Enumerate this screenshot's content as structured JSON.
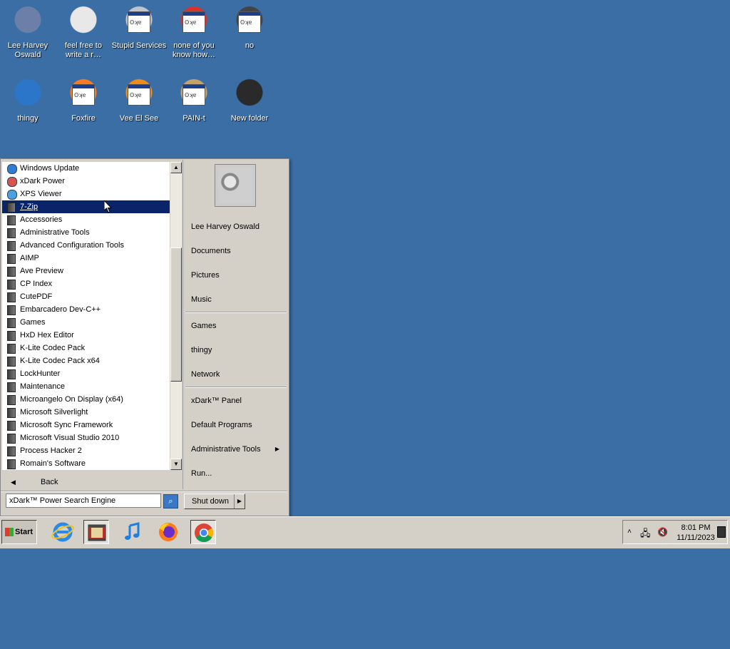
{
  "desktop": {
    "icons": [
      {
        "label": "Lee Harvey\nOswald",
        "icon": "anime-character-icon"
      },
      {
        "label": "feel free to\nwrite a r…",
        "icon": "text-document-icon"
      },
      {
        "label": "Stupid Services",
        "icon": "gear-app-icon"
      },
      {
        "label": "none of you\nknow how…",
        "icon": "red-app-icon"
      },
      {
        "label": "no",
        "icon": "black-box-app-icon"
      },
      {
        "label": "thingy",
        "icon": "blue-orb-icon"
      },
      {
        "label": "Foxfire",
        "icon": "firefox-app-icon"
      },
      {
        "label": "Vee El See",
        "icon": "vlc-app-icon"
      },
      {
        "label": "PAIN-t",
        "icon": "paint-palette-icon"
      },
      {
        "label": "New folder",
        "icon": "dark-folder-icon"
      }
    ]
  },
  "start_menu": {
    "programs": [
      {
        "label": "Windows Update",
        "kind": "app"
      },
      {
        "label": "xDark Power",
        "kind": "app"
      },
      {
        "label": "XPS Viewer",
        "kind": "app"
      },
      {
        "label": "7-Zip",
        "kind": "folder",
        "selected": true
      },
      {
        "label": "Accessories",
        "kind": "folder"
      },
      {
        "label": "Administrative Tools",
        "kind": "folder"
      },
      {
        "label": "Advanced Configuration Tools",
        "kind": "folder"
      },
      {
        "label": "AIMP",
        "kind": "folder"
      },
      {
        "label": "Ave Preview",
        "kind": "folder"
      },
      {
        "label": "CP Index",
        "kind": "folder"
      },
      {
        "label": "CutePDF",
        "kind": "folder"
      },
      {
        "label": "Embarcadero Dev-C++",
        "kind": "folder"
      },
      {
        "label": "Games",
        "kind": "folder"
      },
      {
        "label": "HxD Hex Editor",
        "kind": "folder"
      },
      {
        "label": "K-Lite Codec Pack",
        "kind": "folder"
      },
      {
        "label": "K-Lite Codec Pack x64",
        "kind": "folder"
      },
      {
        "label": "LockHunter",
        "kind": "folder"
      },
      {
        "label": "Maintenance",
        "kind": "folder"
      },
      {
        "label": "Microangelo On Display (x64)",
        "kind": "folder"
      },
      {
        "label": "Microsoft Silverlight",
        "kind": "folder"
      },
      {
        "label": "Microsoft Sync Framework",
        "kind": "folder"
      },
      {
        "label": "Microsoft Visual Studio 2010",
        "kind": "folder"
      },
      {
        "label": "Process Hacker 2",
        "kind": "folder"
      },
      {
        "label": "Romain's Software",
        "kind": "folder"
      }
    ],
    "back_label": "Back",
    "search_value": "xDark™ Power Search Engine",
    "right_items": [
      {
        "label": "Lee Harvey Oswald"
      },
      {
        "label": "Documents"
      },
      {
        "label": "Pictures"
      },
      {
        "label": "Music"
      },
      {
        "label": "Games"
      },
      {
        "label": "thingy"
      },
      {
        "label": "Network"
      },
      {
        "label": "xDark™ Panel"
      },
      {
        "label": "Default Programs"
      },
      {
        "label": "Administrative Tools",
        "submenu": true
      },
      {
        "label": "Run..."
      }
    ],
    "shutdown_label": "Shut down"
  },
  "taskbar": {
    "start_label": "Start",
    "apps": [
      "internet-explorer-icon",
      "film-app-icon",
      "music-note-icon",
      "firefox-icon",
      "chrome-icon"
    ],
    "clock_time": "8:01 PM",
    "clock_date": "11/11/2023"
  },
  "colors": {
    "desktop": "#3a6ea5",
    "selection": "#0a246a",
    "chrome": "#d4d0c8"
  }
}
